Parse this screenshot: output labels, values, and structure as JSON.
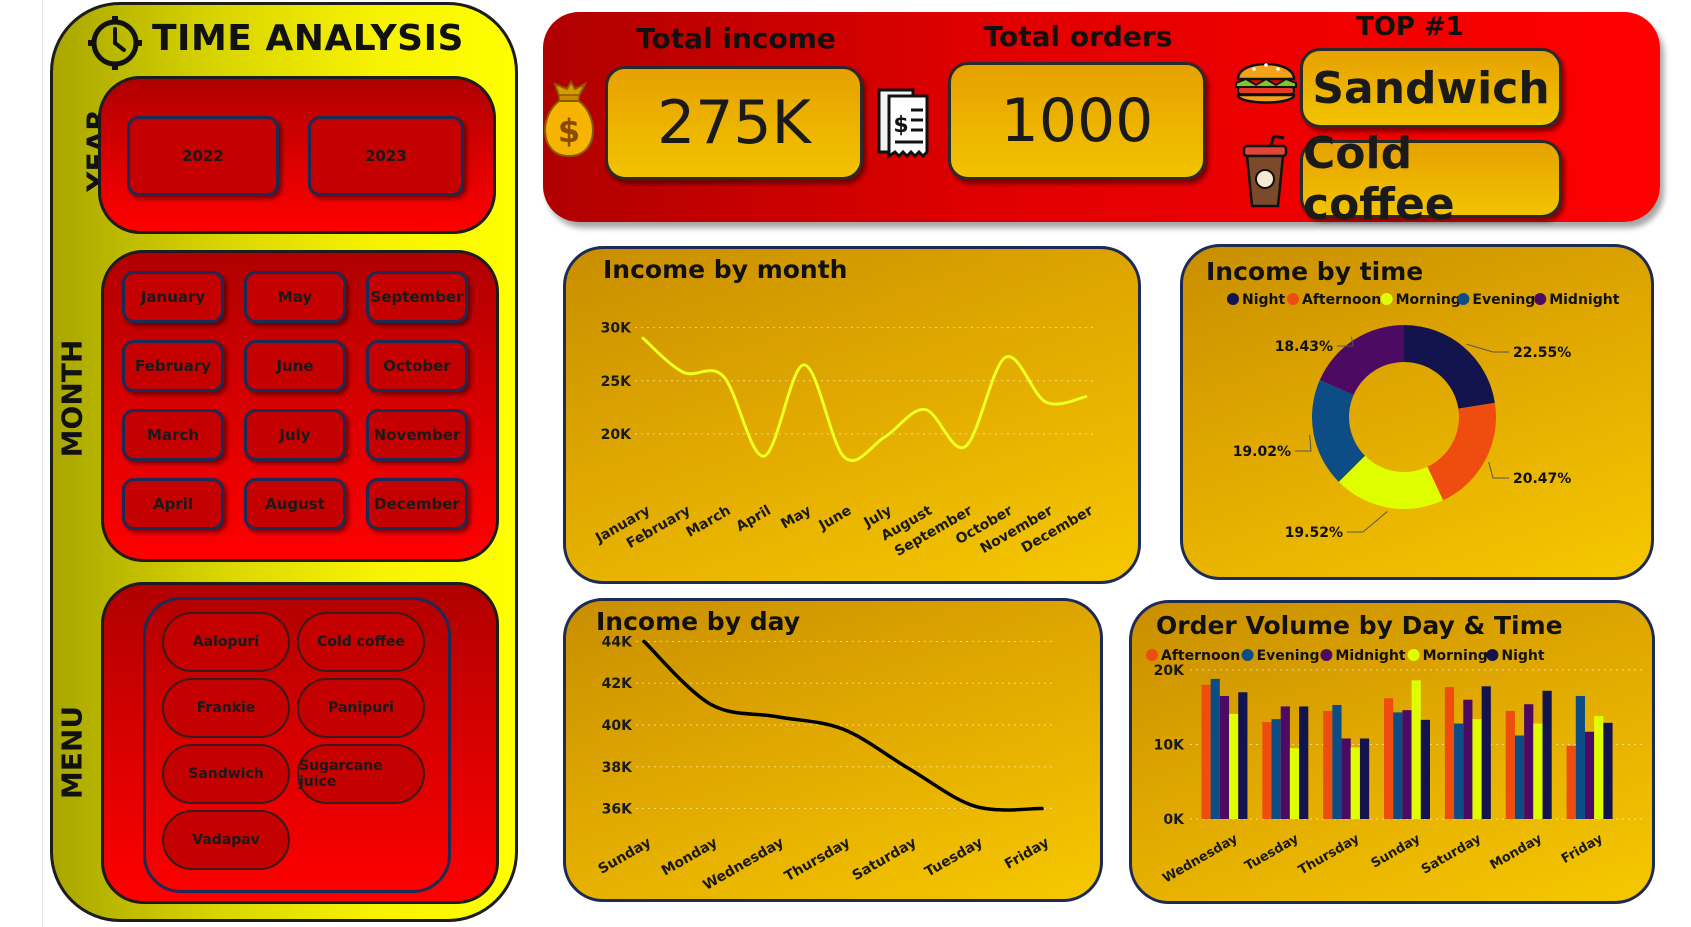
{
  "side": {
    "title": "TIME ANALYSIS",
    "year_label": "YEAR",
    "month_label": "MONTH",
    "menu_label": "MENU",
    "years": [
      "2022",
      "2023"
    ],
    "months": [
      "January",
      "May",
      "September",
      "February",
      "June",
      "October",
      "March",
      "July",
      "November",
      "April",
      "August",
      "December"
    ],
    "menu": [
      "Aalopuri",
      "Cold coffee",
      "Frankie",
      "Panipuri",
      "Sandwich",
      "Sugarcane juice",
      "Vadapav"
    ]
  },
  "kpi": {
    "income_label": "Total income",
    "income_value": "275K",
    "orders_label": "Total orders",
    "orders_value": "1000",
    "top_label": "TOP #1",
    "top_food": "Sandwich",
    "top_drink": "Cold coffee"
  },
  "colors": {
    "night": "#13134e",
    "afternoon": "#ef4d0f",
    "morning": "#dfff00",
    "evening": "#0d4d86",
    "midnight": "#4d0a62",
    "month_line": "#eeff22",
    "day_line": "#000000"
  },
  "chart_data": [
    {
      "type": "line",
      "title": "Income by month",
      "categories": [
        "January",
        "February",
        "March",
        "April",
        "May",
        "June",
        "July",
        "August",
        "September",
        "October",
        "November",
        "December"
      ],
      "values": [
        29000,
        25800,
        25400,
        17900,
        26500,
        17800,
        19700,
        22300,
        18800,
        27200,
        23000,
        23500
      ],
      "ylim": [
        15000,
        31000
      ],
      "yticks": [
        20000,
        25000,
        30000
      ],
      "ytick_labels": [
        "20K",
        "25K",
        "30K"
      ],
      "grid": true
    },
    {
      "type": "line",
      "title": "Income by day",
      "categories": [
        "Sunday",
        "Monday",
        "Wednesday",
        "Thursday",
        "Saturday",
        "Tuesday",
        "Friday"
      ],
      "values": [
        44000,
        41000,
        40400,
        39800,
        37900,
        36100,
        36000
      ],
      "ylim": [
        35500,
        44500
      ],
      "yticks": [
        36000,
        38000,
        40000,
        42000,
        44000
      ],
      "ytick_labels": [
        "36K",
        "38K",
        "40K",
        "42K",
        "44K"
      ],
      "grid": true
    },
    {
      "type": "pie",
      "title": "Income by time",
      "legend": [
        "Night",
        "Afternoon",
        "Morning",
        "Evening",
        "Midnight"
      ],
      "legend_position": "top",
      "slices": [
        {
          "label": "Night",
          "value": 22.55,
          "text": "22.55%"
        },
        {
          "label": "Afternoon",
          "value": 20.47,
          "text": "20.47%"
        },
        {
          "label": "Morning",
          "value": 19.52,
          "text": "19.52%"
        },
        {
          "label": "Evening",
          "value": 19.02,
          "text": "19.02%"
        },
        {
          "label": "Midnight",
          "value": 18.43,
          "text": "18.43%"
        }
      ],
      "donut": true
    },
    {
      "type": "bar",
      "title": "Order Volume by Day & Time",
      "categories": [
        "Wednesday",
        "Tuesday",
        "Thursday",
        "Sunday",
        "Saturday",
        "Monday",
        "Friday"
      ],
      "legend_position": "top",
      "series": [
        {
          "name": "Afternoon",
          "values": [
            18000,
            13000,
            14500,
            16200,
            17700,
            14500,
            9800
          ]
        },
        {
          "name": "Evening",
          "values": [
            18800,
            13400,
            15300,
            14300,
            12800,
            11200,
            16500
          ]
        },
        {
          "name": "Midnight",
          "values": [
            16500,
            15100,
            10800,
            14600,
            16000,
            15400,
            11700
          ]
        },
        {
          "name": "Morning",
          "values": [
            14100,
            9500,
            9600,
            18600,
            13400,
            12800,
            13800
          ]
        },
        {
          "name": "Night",
          "values": [
            17000,
            15100,
            10800,
            13300,
            17800,
            17200,
            12900
          ]
        }
      ],
      "ylim": [
        0,
        22000
      ],
      "yticks": [
        0,
        10000,
        20000
      ],
      "ytick_labels": [
        "0K",
        "10K",
        "20K"
      ],
      "grid": true
    }
  ]
}
